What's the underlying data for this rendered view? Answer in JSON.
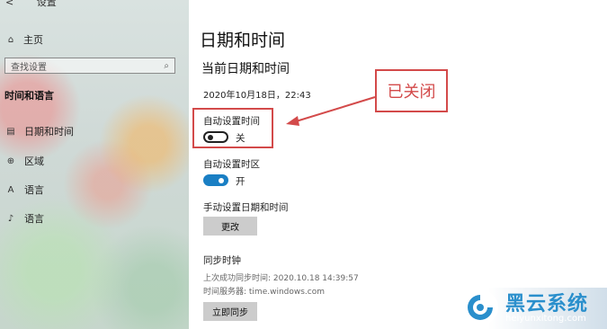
{
  "sidebar": {
    "back_glyph": "<",
    "app_title": "设置",
    "home_label": "主页",
    "search_placeholder": "查找设置",
    "section_title": "时间和语言",
    "items": [
      {
        "icon": "calendar-icon",
        "glyph": "▤",
        "label": "日期和时间"
      },
      {
        "icon": "globe-icon",
        "glyph": "⊕",
        "label": "区域"
      },
      {
        "icon": "language-icon",
        "glyph": "A",
        "label": "语言"
      },
      {
        "icon": "microphone-icon",
        "glyph": "♪",
        "label": "语言"
      }
    ]
  },
  "main": {
    "page_title": "日期和时间",
    "section_title": "当前日期和时间",
    "current_datetime": "2020年10月18日，22:43",
    "auto_time": {
      "label": "自动设置时间",
      "state": "关",
      "on": false
    },
    "auto_timezone": {
      "label": "自动设置时区",
      "state": "开",
      "on": true
    },
    "manual": {
      "label": "手动设置日期和时间",
      "button": "更改"
    },
    "sync": {
      "title": "同步时钟",
      "last_sync": "上次成功同步时间: 2020.10.18 14:39:57",
      "server": "时间服务器: time.windows.com",
      "button": "立即同步"
    }
  },
  "annotation": {
    "callout_text": "已关闭",
    "color": "#d34a4a"
  },
  "watermark": {
    "brand": "黑云系统",
    "url": "heiyunxitong.com"
  },
  "colors": {
    "toggle_on": "#1a7fc4",
    "annotation_red": "#d34a4a"
  }
}
